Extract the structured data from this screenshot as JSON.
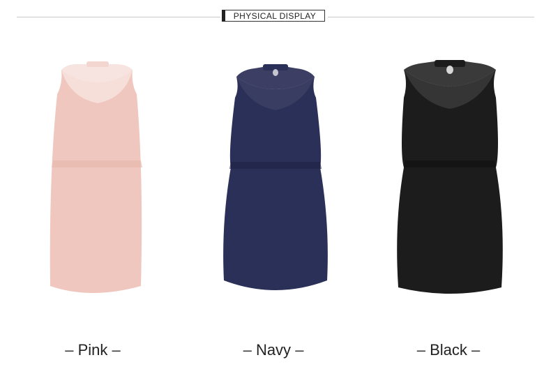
{
  "header": {
    "title": "PHYSICAL DISPLAY"
  },
  "products": [
    {
      "color_name": "Pink",
      "fill": "#f0c7bf",
      "shade": "#e6b5ac",
      "lace": "#f7e4e0"
    },
    {
      "color_name": "Navy",
      "fill": "#2a3057",
      "shade": "#1f2446",
      "lace": "#3c3f63"
    },
    {
      "color_name": "Black",
      "fill": "#1c1c1c",
      "shade": "#111111",
      "lace": "#3a3a3a"
    }
  ],
  "caption_dash": "–"
}
